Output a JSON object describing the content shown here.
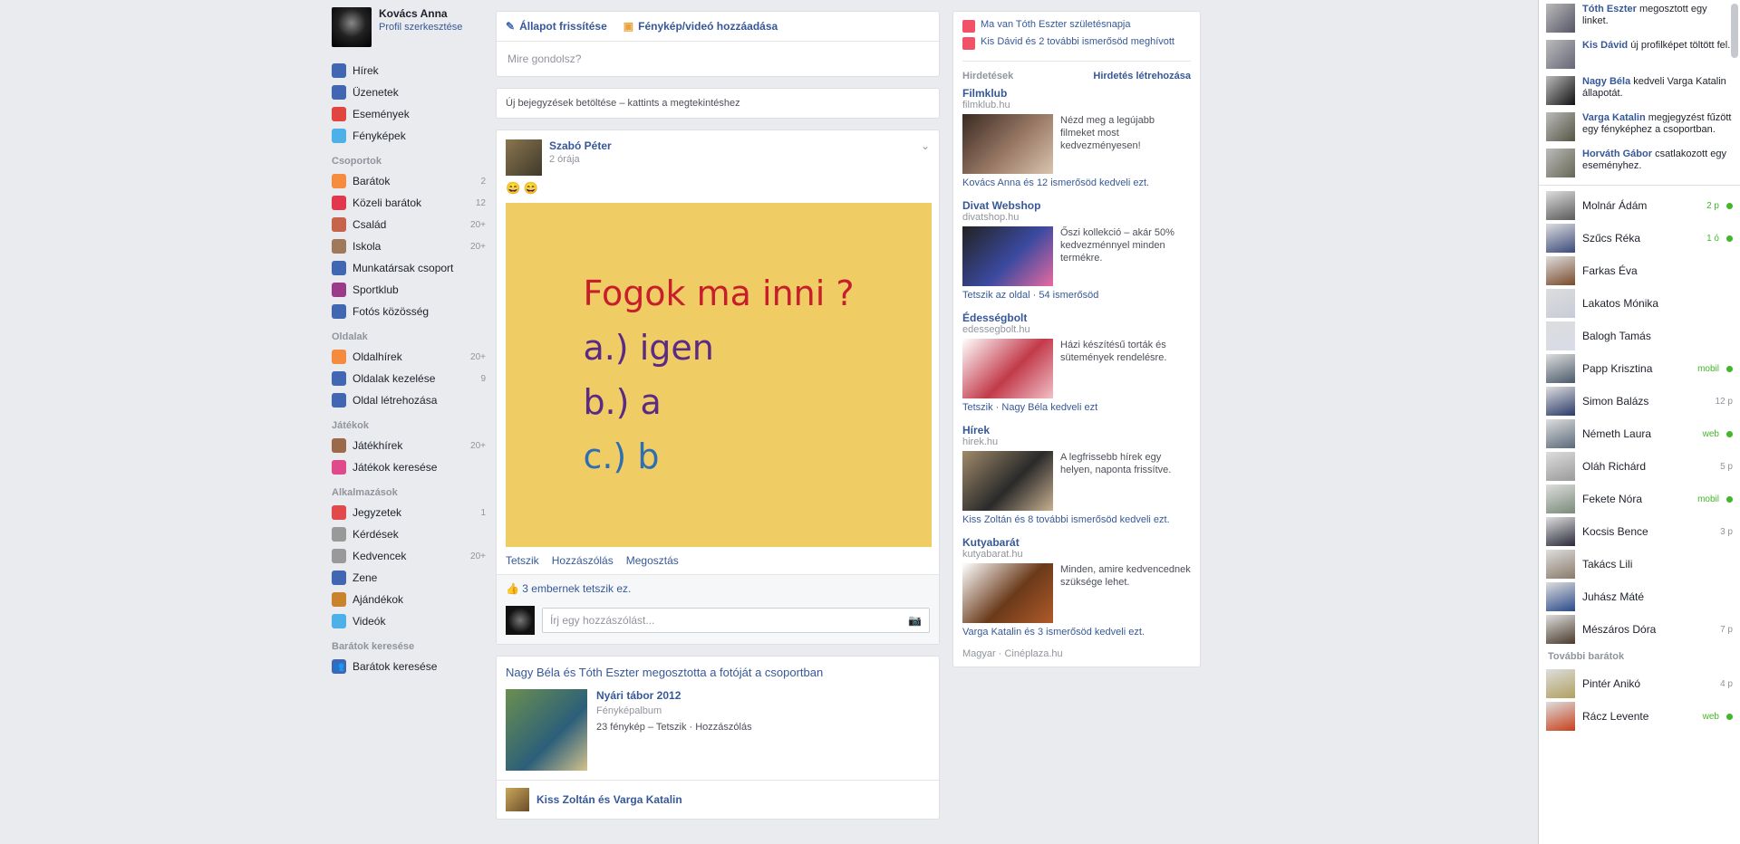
{
  "left_nav": {
    "profile_name": "Kovács Anna",
    "profile_edit": "Profil szerkesztése",
    "items": [
      {
        "label": "Hírek",
        "count": "",
        "color": "#4267b2"
      },
      {
        "label": "Üzenetek",
        "count": "",
        "color": "#4267b2"
      },
      {
        "label": "Események",
        "count": "",
        "color": "#e0453e"
      },
      {
        "label": "Fényképek",
        "count": "",
        "color": "#4db0e8"
      }
    ],
    "groups_head": "Csoportok",
    "groups": [
      {
        "label": "Barátok",
        "count": "2",
        "color": "#f58b3e"
      },
      {
        "label": "Közeli barátok",
        "count": "12",
        "color": "#e2384d"
      },
      {
        "label": "Család",
        "count": "20+",
        "color": "#c5644a"
      },
      {
        "label": "Iskola",
        "count": "20+",
        "color": "#a0785a"
      },
      {
        "label": "Munkatársak csoport",
        "count": "",
        "color": "#4267b2"
      },
      {
        "label": "Sportklub",
        "count": "",
        "color": "#9a3a88"
      },
      {
        "label": "Fotós közösség",
        "count": "",
        "color": "#4267b2"
      }
    ],
    "apps_head": "Oldalak",
    "apps": [
      {
        "label": "Oldalhírek",
        "count": "20+",
        "color": "#f58b3e"
      },
      {
        "label": "Oldalak kezelése",
        "count": "9",
        "color": "#4267b2"
      },
      {
        "label": "Oldal létrehozása",
        "count": "",
        "color": "#4267b2"
      }
    ],
    "games_head": "Játékok",
    "games": [
      {
        "label": "Játékhírek",
        "count": "20+",
        "color": "#9a6a4a"
      },
      {
        "label": "Játékok keresése",
        "count": "",
        "color": "#e04a8a"
      }
    ],
    "more_head": "Alkalmazások",
    "more": [
      {
        "label": "Jegyzetek",
        "count": "1",
        "color": "#e04a4a"
      },
      {
        "label": "Kérdések",
        "count": "",
        "color": "#999999"
      },
      {
        "label": "Kedvencek",
        "count": "20+",
        "color": "#999999"
      },
      {
        "label": "Zene",
        "count": "",
        "color": "#4267b2"
      },
      {
        "label": "Ajándékok",
        "count": "",
        "color": "#c9832c"
      },
      {
        "label": "Videók",
        "count": "",
        "color": "#4db0e8"
      }
    ],
    "friends_head": "Barátok keresése",
    "friends_link": "Barátok keresése"
  },
  "composer": {
    "status_label": "Állapot frissítése",
    "photo_label": "Fénykép/videó hozzáadása",
    "placeholder": "Mire gondolsz?"
  },
  "notice": "Új bejegyzések betöltése – kattints a megtekintéshez",
  "post": {
    "author": "Szabó Péter",
    "time": "2 órája",
    "text": "😄 😄",
    "image_lines": {
      "q": "Fogok ma inni ?",
      "a": "a.) igen",
      "b": "b.) a",
      "c": "c.) b"
    },
    "actions": [
      "Tetszik",
      "Hozzászólás",
      "Megosztás"
    ],
    "likes": "3 embernek tetszik ez.",
    "comment_placeholder": "Írj egy hozzászólást..."
  },
  "shared_post": {
    "title": "Nagy Béla és Tóth Eszter megosztotta a fotóját a csoportban",
    "name": "Nyári tábor 2012",
    "sub": "Fényképalbum",
    "line": "23 fénykép – Tetszik · Hozzászólás",
    "next_author": "Kiss Zoltán és Varga Katalin"
  },
  "right_col": {
    "events": [
      "Ma van Tóth Eszter születésnapja",
      "Kis Dávid és 2 további ismerősöd meghívott"
    ],
    "sponsored_head": "Hirdetések",
    "create_ad": "Hirdetés létrehozása",
    "ads": [
      {
        "title": "Filmklub",
        "url": "filmklub.hu",
        "desc": "Nézd meg a legújabb filmeket most kedvezményesen!",
        "social": "Kovács Anna és 12 ismerősöd kedveli ezt.",
        "img": [
          "#3a2a22",
          "#9a7a66",
          "#d8c4b0"
        ]
      },
      {
        "title": "Divat Webshop",
        "url": "divatshop.hu",
        "desc": "Őszi kollekció – akár 50% kedvezménnyel minden termékre.",
        "social": "Tetszik az oldal · 54 ismerősöd",
        "img": [
          "#222",
          "#3b4aa0",
          "#e86aa0"
        ]
      },
      {
        "title": "Édességbolt",
        "url": "edessegbolt.hu",
        "desc": "Házi készítésű torták és sütemények rendelésre.",
        "social": "Tetszik · Nagy Béla kedveli ezt",
        "img": [
          "#fff",
          "#c23a4a",
          "#f0c0c8"
        ]
      },
      {
        "title": "Hírek",
        "url": "hirek.hu",
        "desc": "A legfrissebb hírek egy helyen, naponta frissítve.",
        "social": "Kiss Zoltán és 8 további ismerősöd kedveli ezt.",
        "img": [
          "#a08a6a",
          "#2a2a2a",
          "#c8b090"
        ]
      },
      {
        "title": "Kutyabarát",
        "url": "kutyabarat.hu",
        "desc": "Minden, amire kedvencednek szüksége lehet.",
        "social": "Varga Katalin és 3 ismerősöd kedveli ezt.",
        "img": [
          "#fff",
          "#6a3a1a",
          "#b05a2a"
        ]
      }
    ],
    "footer": "Magyar · Cinéplaza.hu"
  },
  "chat": {
    "stories": [
      {
        "name": "Tóth Eszter",
        "text": "megosztott egy linket.",
        "color": "#556"
      },
      {
        "name": "Kis Dávid",
        "text": "új profilképet töltött fel.",
        "color": "#667"
      },
      {
        "name": "Nagy Béla",
        "text": "kedveli Varga Katalin állapotát.",
        "color": "#111"
      },
      {
        "name": "Varga Katalin",
        "text": "megjegyzést fűzött egy fényképhez a csoportban.",
        "color": "#554"
      },
      {
        "name": "Horváth Gábor",
        "text": "csatlakozott egy eseményhez.",
        "color": "#665"
      }
    ],
    "friends": [
      {
        "name": "Molnár Ádám",
        "status": "2 p",
        "online": true
      },
      {
        "name": "Szűcs Réka",
        "status": "1 ó",
        "online": true
      },
      {
        "name": "Farkas Éva",
        "status": "",
        "online": false
      },
      {
        "name": "Lakatos Mónika",
        "status": "",
        "online": false
      },
      {
        "name": "Balogh Tamás",
        "status": "",
        "online": false
      },
      {
        "name": "Papp Krisztina",
        "status": "mobil",
        "online": true
      },
      {
        "name": "Simon Balázs",
        "status": "12 p",
        "online": false
      },
      {
        "name": "Németh Laura",
        "status": "web",
        "online": true
      },
      {
        "name": "Oláh Richárd",
        "status": "5 p",
        "online": false
      },
      {
        "name": "Fekete Nóra",
        "status": "mobil",
        "online": true
      },
      {
        "name": "Kocsis Bence",
        "status": "3 p",
        "online": false
      },
      {
        "name": "Takács Lili",
        "status": "",
        "online": false
      },
      {
        "name": "Juhász Máté",
        "status": "",
        "online": false
      },
      {
        "name": "Mészáros Dóra",
        "status": "7 p",
        "online": false
      }
    ],
    "more_head": "További barátok",
    "more": [
      {
        "name": "Pintér Anikó",
        "status": "4 p",
        "online": false
      },
      {
        "name": "Rácz Levente",
        "status": "web",
        "online": true
      }
    ],
    "avatar_colors": [
      "#5a5a5a",
      "#3a4a7a",
      "#7a4a2a",
      "#c8ccd8",
      "#d8dce8",
      "#4a5a6a",
      "#2a3a6a",
      "#5a6a7a",
      "#9a9a9a",
      "#7a8a7a",
      "#2a2a3a",
      "#8a7a6a",
      "#2a4a8a",
      "#4a3a2a",
      "#d8701a",
      "#b0a060",
      "#c8401a"
    ]
  }
}
